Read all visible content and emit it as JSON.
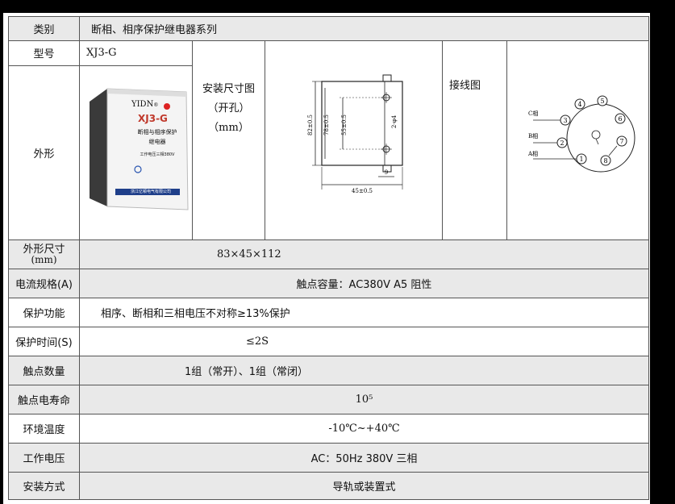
{
  "category": {
    "label": "类别",
    "value": "断相、相序保护继电器系列"
  },
  "model": {
    "label": "型号",
    "value": "XJ3-G"
  },
  "appearance": {
    "label": "外形"
  },
  "product": {
    "brand": "YIDN",
    "brand_sub": "®",
    "name": "XJ3-G",
    "desc_line1": "断相与相序保护",
    "desc_line2": "继电器",
    "voltage": "工作电压三相380V",
    "maker": "浙江亿顿电气有限公司"
  },
  "mounting": {
    "title": "安装尺寸图",
    "line2": "（开孔）",
    "line3": "（mm）"
  },
  "dimension_drawing": {
    "dim_82": "82±0.5",
    "dim_78": "78±0.5",
    "dim_55": "55±0.5",
    "dim_hole": "2-φ4",
    "dim_9": "9",
    "dim_45": "45±0.5"
  },
  "wiring": {
    "label": "接线图",
    "phase_c": "C相",
    "phase_b": "B相",
    "phase_a": "A相",
    "pins": [
      "1",
      "2",
      "3",
      "4",
      "5",
      "6",
      "7",
      "8"
    ]
  },
  "rows": [
    {
      "label": "外形尺寸",
      "label_sub": "(mm)",
      "value": "83×45×112",
      "align": "left",
      "indent": 170
    },
    {
      "label": "电流规格(A)",
      "value": "触点容量：AC380V A5 阻性",
      "align": "center"
    },
    {
      "label": "保护功能",
      "value": "相序、断相和三相电压不对称≥13%保护",
      "align": "left",
      "indent": 26,
      "white": true
    },
    {
      "label": "保护时间(S)",
      "value": "≤2S",
      "align": "left",
      "indent": 206,
      "white": true
    },
    {
      "label": "触点数量",
      "value": "1组（常开）、1组（常闭）",
      "align": "left",
      "indent": 130
    },
    {
      "label": "触点电寿命",
      "value": "10⁵",
      "align": "center"
    },
    {
      "label": "环境温度",
      "value": "-10℃~+40℃",
      "align": "center",
      "white": true
    },
    {
      "label": "工作电压",
      "value": "AC：50Hz 380V 三相",
      "align": "center"
    },
    {
      "label": "安装方式",
      "value": "导轨或装置式",
      "align": "center"
    }
  ]
}
